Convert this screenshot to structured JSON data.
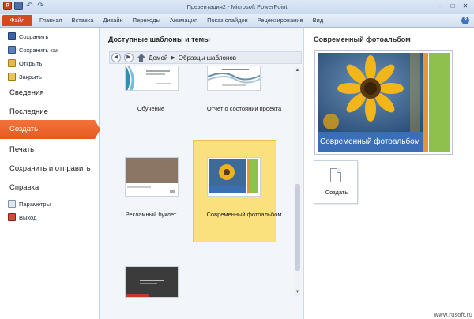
{
  "window": {
    "title": "Презентация2 - Microsoft PowerPoint",
    "controls": [
      "–",
      "□",
      "✕"
    ]
  },
  "ribbon": {
    "file_tab": "Файл",
    "tabs": [
      "Главная",
      "Вставка",
      "Дизайн",
      "Переходы",
      "Анимация",
      "Показ слайдов",
      "Рецензирование",
      "Вид"
    ]
  },
  "backstage_nav": {
    "save": "Сохранить",
    "save_as": "Сохранить как",
    "open": "Открыть",
    "close": "Закрыть",
    "info": "Сведения",
    "recent": "Последние",
    "new": "Создать",
    "print": "Печать",
    "save_send": "Сохранить и отправить",
    "help": "Справка",
    "options": "Параметры",
    "exit": "Выход"
  },
  "templates_panel": {
    "title": "Доступные шаблоны и темы",
    "breadcrumb": {
      "home": "Домой",
      "current": "Образцы шаблонов"
    },
    "items": [
      {
        "label": "Обучение"
      },
      {
        "label": "Отчет о состоянии проекта"
      },
      {
        "label": "Рекламный буклет"
      },
      {
        "label": "Современный фотоальбом",
        "selected": true
      },
      {
        "label": ""
      }
    ]
  },
  "preview_panel": {
    "title": "Современный фотоальбом",
    "banner_text": "Современный фотоальбом",
    "create_button": "Создать"
  },
  "watermark": "www.rusoft.ru",
  "colors": {
    "accent": "#e35a22",
    "selection": "#fbe07e",
    "album_blue": "#3a6fb5",
    "album_green": "#8fbf4c",
    "album_orange": "#e8923c"
  }
}
